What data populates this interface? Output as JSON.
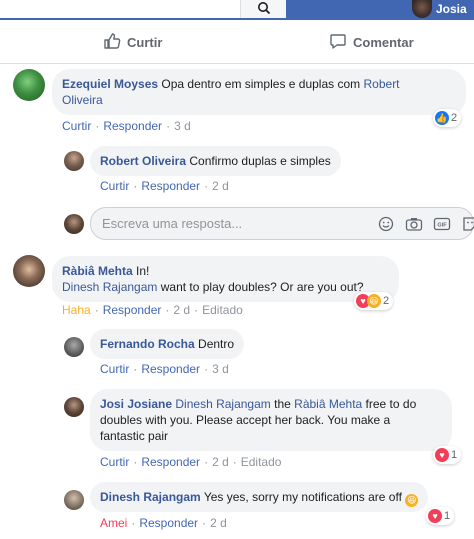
{
  "topbar": {
    "profile_name": "Josia"
  },
  "actions": {
    "like_label": "Curtir",
    "comment_label": "Comentar"
  },
  "comments": [
    {
      "author": "Ezequiel Moyses",
      "text": "Opa dentro em simples e duplas com",
      "mention": "Robert",
      "mention2": "Oliveira",
      "meta": {
        "like": "Curtir",
        "reply": "Responder",
        "time": "3 d"
      },
      "reaction_count": "2"
    },
    {
      "author": "Robert Oliveira",
      "text": "Confirmo duplas e simples",
      "meta": {
        "like": "Curtir",
        "reply": "Responder",
        "time": "2 d"
      }
    },
    {
      "author": "Ràbiâ Mehta",
      "text_line1": "In!",
      "mention": "Dinesh Rajangam",
      "text_line2": "want to play doubles? Or are you out?",
      "meta": {
        "like": "Haha",
        "reply": "Responder",
        "time": "2 d",
        "edited": "Editado"
      },
      "reaction_count": "2"
    },
    {
      "author": "Fernando Rocha",
      "text": "Dentro",
      "meta": {
        "like": "Curtir",
        "reply": "Responder",
        "time": "3 d"
      }
    },
    {
      "author": "Josi Josiane",
      "mention1": "Dinesh Rajangam",
      "text1": "the",
      "mention2": "Ràbiâ Mehta",
      "text2": "free to do",
      "line2": "doubles with you. Please accept her back. You make a",
      "line3": "fantastic pair",
      "meta": {
        "like": "Curtir",
        "reply": "Responder",
        "time": "2 d",
        "edited": "Editado"
      },
      "reaction_count": "1"
    },
    {
      "author": "Dinesh Rajangam",
      "text": "Yes yes, sorry my notifications are off",
      "meta": {
        "like": "Amei",
        "reply": "Responder",
        "time": "2 d"
      },
      "reaction_count": "1"
    }
  ],
  "reply_box": {
    "placeholder": "Escreva uma resposta..."
  },
  "colors": {
    "facebook_blue": "#4267b2",
    "link": "#385898",
    "bubble": "#f2f3f5",
    "love": "#f33e58",
    "haha": "#f7b125"
  }
}
